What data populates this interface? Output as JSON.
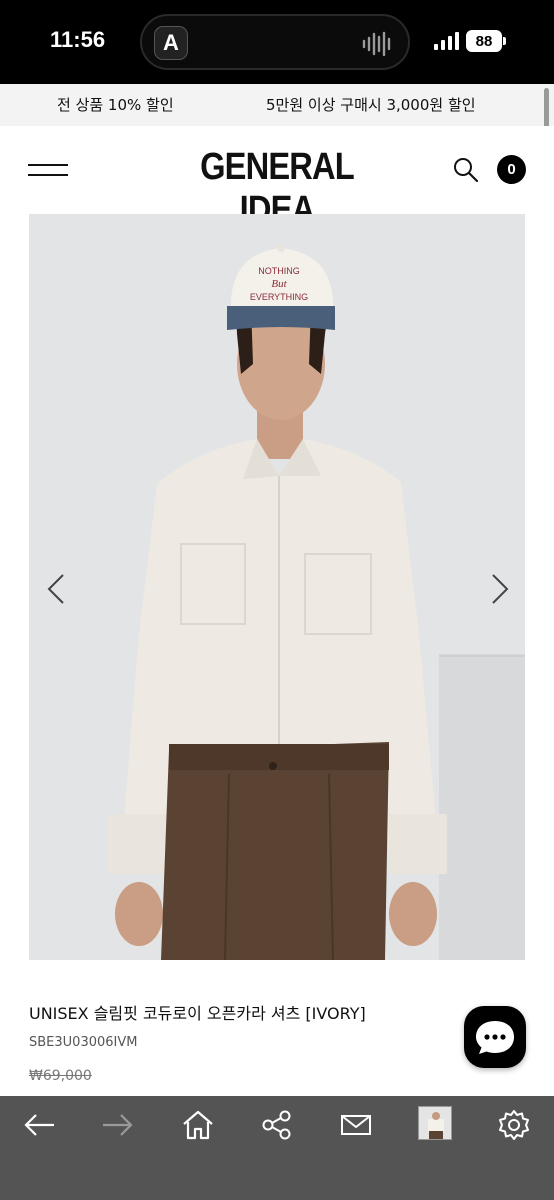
{
  "status_bar": {
    "time": "11:56",
    "island_app_letter": "A",
    "battery": "88",
    "icons": [
      "signal-icon",
      "battery-icon",
      "audio-wave-icon"
    ]
  },
  "promo": {
    "left": "전 상품 10% 할인",
    "right": "5만원 이상 구매시 3,000원 할인"
  },
  "header": {
    "logo": "GENERAL IDEA",
    "cart_count": "0",
    "icons": [
      "menu-icon",
      "search-icon"
    ]
  },
  "gallery": {
    "cap_text": "NOTHING\nBut\nEVERYTHING",
    "icons": [
      "chevron-left-icon",
      "chevron-right-icon"
    ]
  },
  "product": {
    "name": "UNISEX 슬림핏 코듀로이 오픈카라 셔츠 [IVORY]",
    "code": "SBE3U03006IVM",
    "price_original": "₩69,000"
  },
  "chat": {
    "icon": "chat-bubble-icon"
  },
  "browser_bar": {
    "icons": [
      "back-arrow-icon",
      "forward-arrow-icon",
      "home-icon",
      "share-icon",
      "mail-icon",
      "tab-thumbnail",
      "settings-gear-icon"
    ]
  },
  "colors": {
    "status_bg": "#000000",
    "promo_bg": "#f3f3f3",
    "image_bg": "#e3e4e6",
    "bottom_bar_bg": "#545454",
    "shirt": "#eeeae3",
    "pants": "#5b4333",
    "cap_brim": "#4a5f7a"
  }
}
